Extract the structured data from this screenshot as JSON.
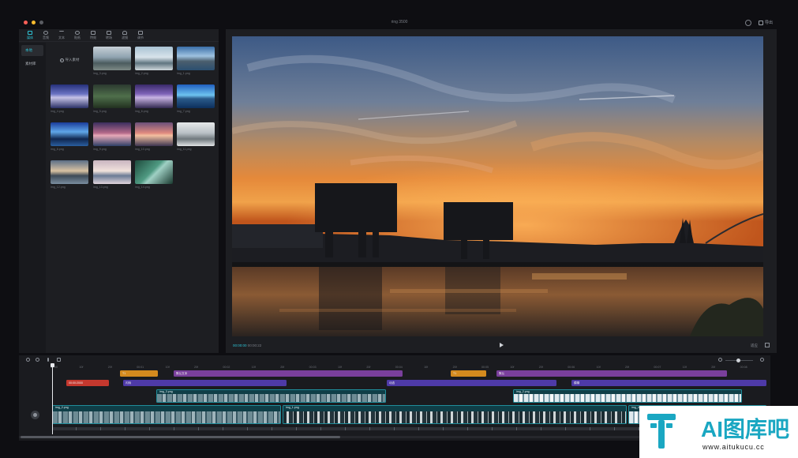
{
  "window": {
    "title": "ring 3500"
  },
  "titlebar": {
    "traffic": [
      "#ff5f57",
      "#febc2e",
      "#5a5c62"
    ],
    "export_label": "导出"
  },
  "toolbar": {
    "tools": [
      {
        "label": "媒体",
        "icon": "media-icon",
        "active": true
      },
      {
        "label": "音频",
        "icon": "audio-icon"
      },
      {
        "label": "文本",
        "icon": "text-icon"
      },
      {
        "label": "贴纸",
        "icon": "sticker-icon"
      },
      {
        "label": "特效",
        "icon": "effects-icon"
      },
      {
        "label": "转场",
        "icon": "transition-icon"
      },
      {
        "label": "滤镜",
        "icon": "filter-icon"
      },
      {
        "label": "调节",
        "icon": "adjust-icon"
      }
    ]
  },
  "sidebar": {
    "items": [
      {
        "label": "本地",
        "active": true
      },
      {
        "label": "素材库"
      }
    ]
  },
  "media": {
    "import_label": "导入素材",
    "items": [
      {
        "label": "img_3.png"
      },
      {
        "label": "img_2.png"
      },
      {
        "label": "img_1.png"
      },
      {
        "label": "img_4.png"
      },
      {
        "label": "img_5.png"
      },
      {
        "label": "img_6.png"
      },
      {
        "label": "img_7.png"
      },
      {
        "label": "img_8.png"
      },
      {
        "label": "img_9.png"
      },
      {
        "label": "img_10.png"
      },
      {
        "label": "img_11.png"
      },
      {
        "label": "img_12.png"
      },
      {
        "label": "img_13.png"
      },
      {
        "label": "img_14.png"
      }
    ]
  },
  "player": {
    "current_time": "00:00:00",
    "total_time": "00:00:22",
    "ratio": "适应"
  },
  "timeline": {
    "ticks": [
      "00:00",
      "10f",
      "20f",
      "00:01",
      "10f",
      "20f",
      "00:02",
      "10f",
      "20f",
      "00:03",
      "10f",
      "20f",
      "00:04",
      "10f",
      "20f",
      "00:05",
      "10f",
      "20f",
      "00:06",
      "10f",
      "20f",
      "00:07",
      "10f",
      "20f",
      "00:08"
    ],
    "clips": {
      "orange_1": "T1",
      "purple_1": "默认文本",
      "orange_2": "T1",
      "purple_2": "默认",
      "red_1": "00:00:2000",
      "violet_1": "闪烁",
      "violet_2": "动态",
      "violet_3": "模糊",
      "video_top_1": "img_3.png",
      "video_top_2": "img_2.png",
      "main_1": "img_2.png",
      "main_2": "img_1.png",
      "main_3": "img_4.png"
    }
  },
  "watermark": {
    "name": "AI图库吧",
    "url": "www.aitukucu.cc"
  }
}
